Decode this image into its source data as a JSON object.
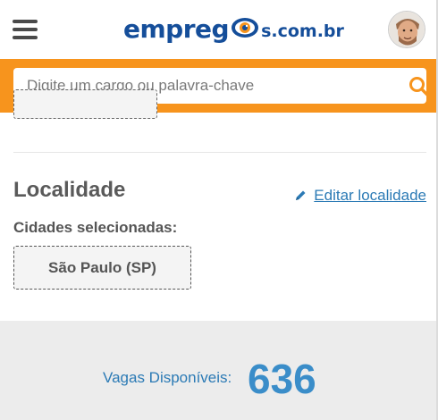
{
  "header": {
    "logo_main": "empreg",
    "logo_suffix": "s.com.br",
    "brand_color": "#154e9a",
    "menu_icon": "hamburger-menu-icon",
    "avatar": "user-avatar"
  },
  "search": {
    "placeholder": "Digite um cargo ou palavra-chave",
    "value": "",
    "band_color": "#f7941d",
    "icon": "search-icon"
  },
  "location": {
    "title": "Localidade",
    "edit_label": "Editar localidade",
    "edit_icon": "pencil-icon",
    "cities_label": "Cidades selecionadas:",
    "cities": [
      "São Paulo (SP)"
    ]
  },
  "counter": {
    "label": "Vagas Disponíveis:",
    "value": "636",
    "color": "#3a8dc9"
  }
}
